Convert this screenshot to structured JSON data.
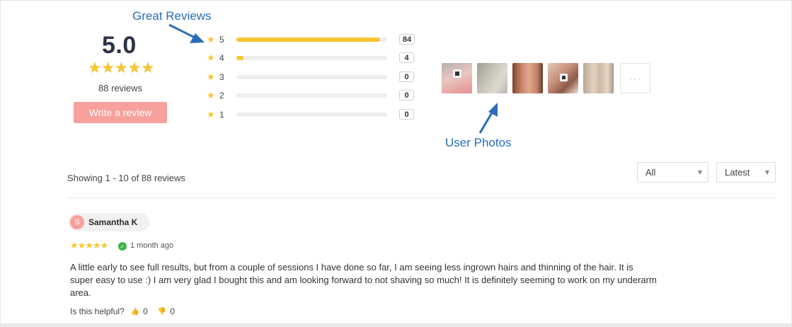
{
  "annotations": {
    "great_reviews": "Great Reviews",
    "user_photos": "User Photos"
  },
  "summary": {
    "average": "5.0",
    "stars": "★★★★★",
    "review_count_label": "88 reviews",
    "write_review_label": "Write a review"
  },
  "breakdown": [
    {
      "star_label": "5",
      "count": "84",
      "fraction": 0.9524
    },
    {
      "star_label": "4",
      "count": "4",
      "fraction": 0.045
    },
    {
      "star_label": "3",
      "count": "0",
      "fraction": 0
    },
    {
      "star_label": "2",
      "count": "0",
      "fraction": 0
    },
    {
      "star_label": "1",
      "count": "0",
      "fraction": 0
    }
  ],
  "photos": {
    "more_label": "···"
  },
  "toolbar": {
    "showing_label": "Showing 1 - 10 of 88 reviews",
    "filter_value": "All",
    "sort_value": "Latest"
  },
  "colors": {
    "accent": "#f8a09b",
    "star": "#f7c531",
    "annotation": "#2a6db5",
    "verified": "#3cb54a"
  },
  "reviews": [
    {
      "avatar_initial": "S",
      "author": "Samantha K",
      "stars": "★★★★★",
      "time": "1 month ago",
      "body": "A little early to see full results, but from a couple of sessions I have done so far, I am seeing less ingrown hairs and thinning of the hair. It is super easy to use :) I am very glad I bought this and am looking forward to not shaving so much! It is definitely seeming to work on my underarm area.",
      "helpful_label": "Is this helpful?",
      "helpful_up": "0",
      "helpful_down": "0"
    }
  ]
}
